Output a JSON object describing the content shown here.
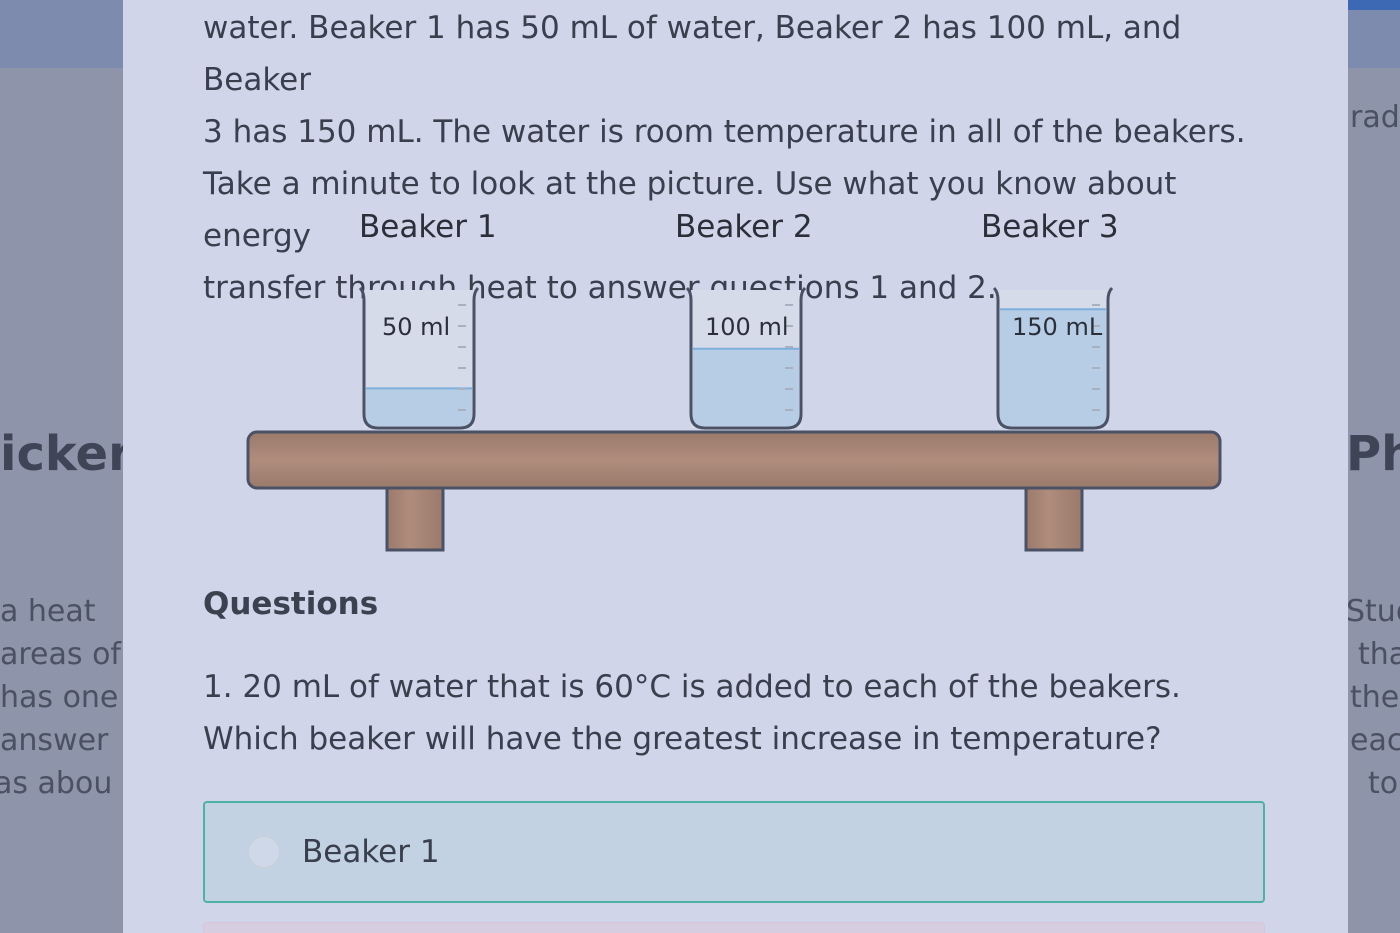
{
  "background": {
    "left_heading": "icker",
    "left_lines": [
      "a heat",
      "areas of",
      "has one",
      "answer",
      "as abou"
    ],
    "right_top": "rade",
    "right_heading": "Ph",
    "right_lines": [
      "Stud",
      "tha",
      "ther",
      "eac",
      "to"
    ]
  },
  "intro": {
    "lines": [
      "water. Beaker 1 has 50 mL of water, Beaker 2 has 100 mL, and Beaker",
      "3 has 150 mL. The water is room temperature in all of the beakers.",
      "Take a minute to look at the picture. Use what you know about energy",
      "transfer through heat to answer questions 1 and 2."
    ]
  },
  "figure": {
    "beakers": [
      {
        "title": "Beaker 1",
        "volume_label": "50 ml",
        "fill_fraction": 0.3
      },
      {
        "title": "Beaker 2",
        "volume_label": "100 ml",
        "fill_fraction": 0.6
      },
      {
        "title": "Beaker 3",
        "volume_label": "150 mL",
        "fill_fraction": 0.9
      }
    ],
    "colors": {
      "water": "#b7cde6",
      "water_line": "#7fb0dc",
      "glass": "#d5dbe9",
      "outline": "#4b5266",
      "shelf": "#9a7a6c",
      "shelf_highlight": "#b08c7c"
    }
  },
  "questions": {
    "heading": "Questions",
    "q1": {
      "text": "1. 20 mL of water that is 60°C is added to each of the beakers. Which beaker will have the greatest increase in temperature?",
      "options": [
        "Beaker 1"
      ],
      "selected": null
    }
  }
}
